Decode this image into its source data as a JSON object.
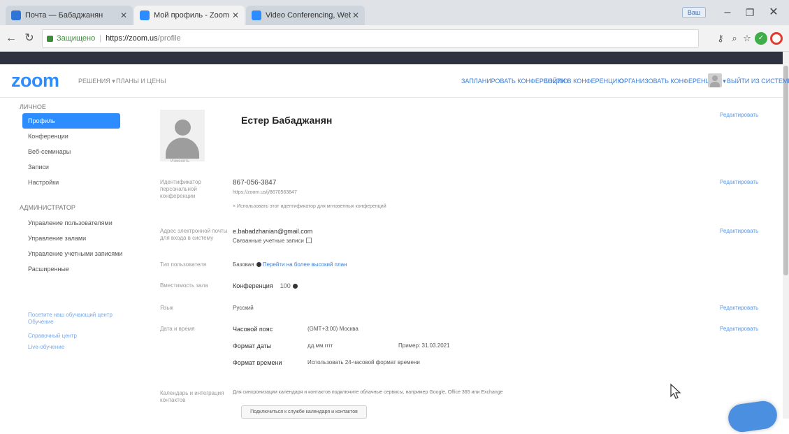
{
  "browser": {
    "tabs": [
      {
        "title": "Почта — Бабаджанян",
        "active": false,
        "favicon_color": "#2f74d6"
      },
      {
        "title": "Мой профиль - Zoom",
        "active": true,
        "favicon_color": "#2d8cff"
      },
      {
        "title": "Video Conferencing, Web",
        "active": false,
        "favicon_color": "#2d8cff"
      }
    ],
    "window_user": "Ваш",
    "secure_label": "Защищено",
    "url_host": "https://zoom.us",
    "url_path": "/profile"
  },
  "header": {
    "logo": "zoom",
    "nav_left": [
      "РЕШЕНИЯ ▾",
      "ПЛАНЫ И ЦЕНЫ"
    ],
    "nav_right": [
      "ЗАПЛАНИРОВАТЬ КОНФЕРЕНЦИЮ",
      "ВОЙТИ В КОНФЕРЕНЦИЮ",
      "ОРГАНИЗОВАТЬ КОНФЕРЕНЦИЮ ▾",
      "ВЫЙТИ ИЗ СИСТЕМЫ"
    ]
  },
  "sidebar": {
    "personal_header": "ЛИЧНОЕ",
    "personal_items": [
      "Профиль",
      "Конференции",
      "Веб-семинары",
      "Записи",
      "Настройки"
    ],
    "admin_header": "АДМИНИСТРАТОР",
    "admin_items": [
      "Управление пользователями",
      "Управление залами",
      "Управление учетными записями",
      "Расширенные"
    ],
    "links": [
      "Посетите наш обучающий центр",
      "Обучение",
      "Справочный центр",
      "Live-обучение"
    ]
  },
  "profile": {
    "name": "Естер Бабаджанян",
    "avatar_caption": "Изменить",
    "edit_label": "Редактировать",
    "rows": [
      {
        "label": "Идентификатор персональной конференции",
        "value": "867-056-3847",
        "sub": "https://zoom.us/j/8670563847",
        "note": "× Использовать этот идентификатор для мгновенных конференций"
      },
      {
        "label": "Адрес электронной почты для входа в систему",
        "value": "e.babadzhanian@gmail.com",
        "sub": "Связанные учетные записи"
      },
      {
        "label": "Тип пользователя",
        "value": "Базовая",
        "sub": "Перейти на более высокий план"
      },
      {
        "label": "Вместимость зала",
        "value": "Конференция",
        "sub": "100"
      },
      {
        "label": "Язык",
        "value": "Русский"
      },
      {
        "label": "Дата и время",
        "value": "Часовой пояс",
        "sub": "(GMT+3:00) Москва",
        "extra": [
          {
            "k": "Формат даты",
            "v": "дд.мм.гггг",
            "ex": "Пример: 31.03.2021"
          },
          {
            "k": "Формат времени",
            "v": "Использовать 24-часовой формат времени"
          }
        ]
      },
      {
        "label": "Календарь и интеграция контактов",
        "value": "Для синхронизации календаря и контактов подключите облачные сервисы, например Google, Office 365 или Exchange"
      }
    ],
    "connect_button": "Подключиться к службе календаря и контактов"
  }
}
